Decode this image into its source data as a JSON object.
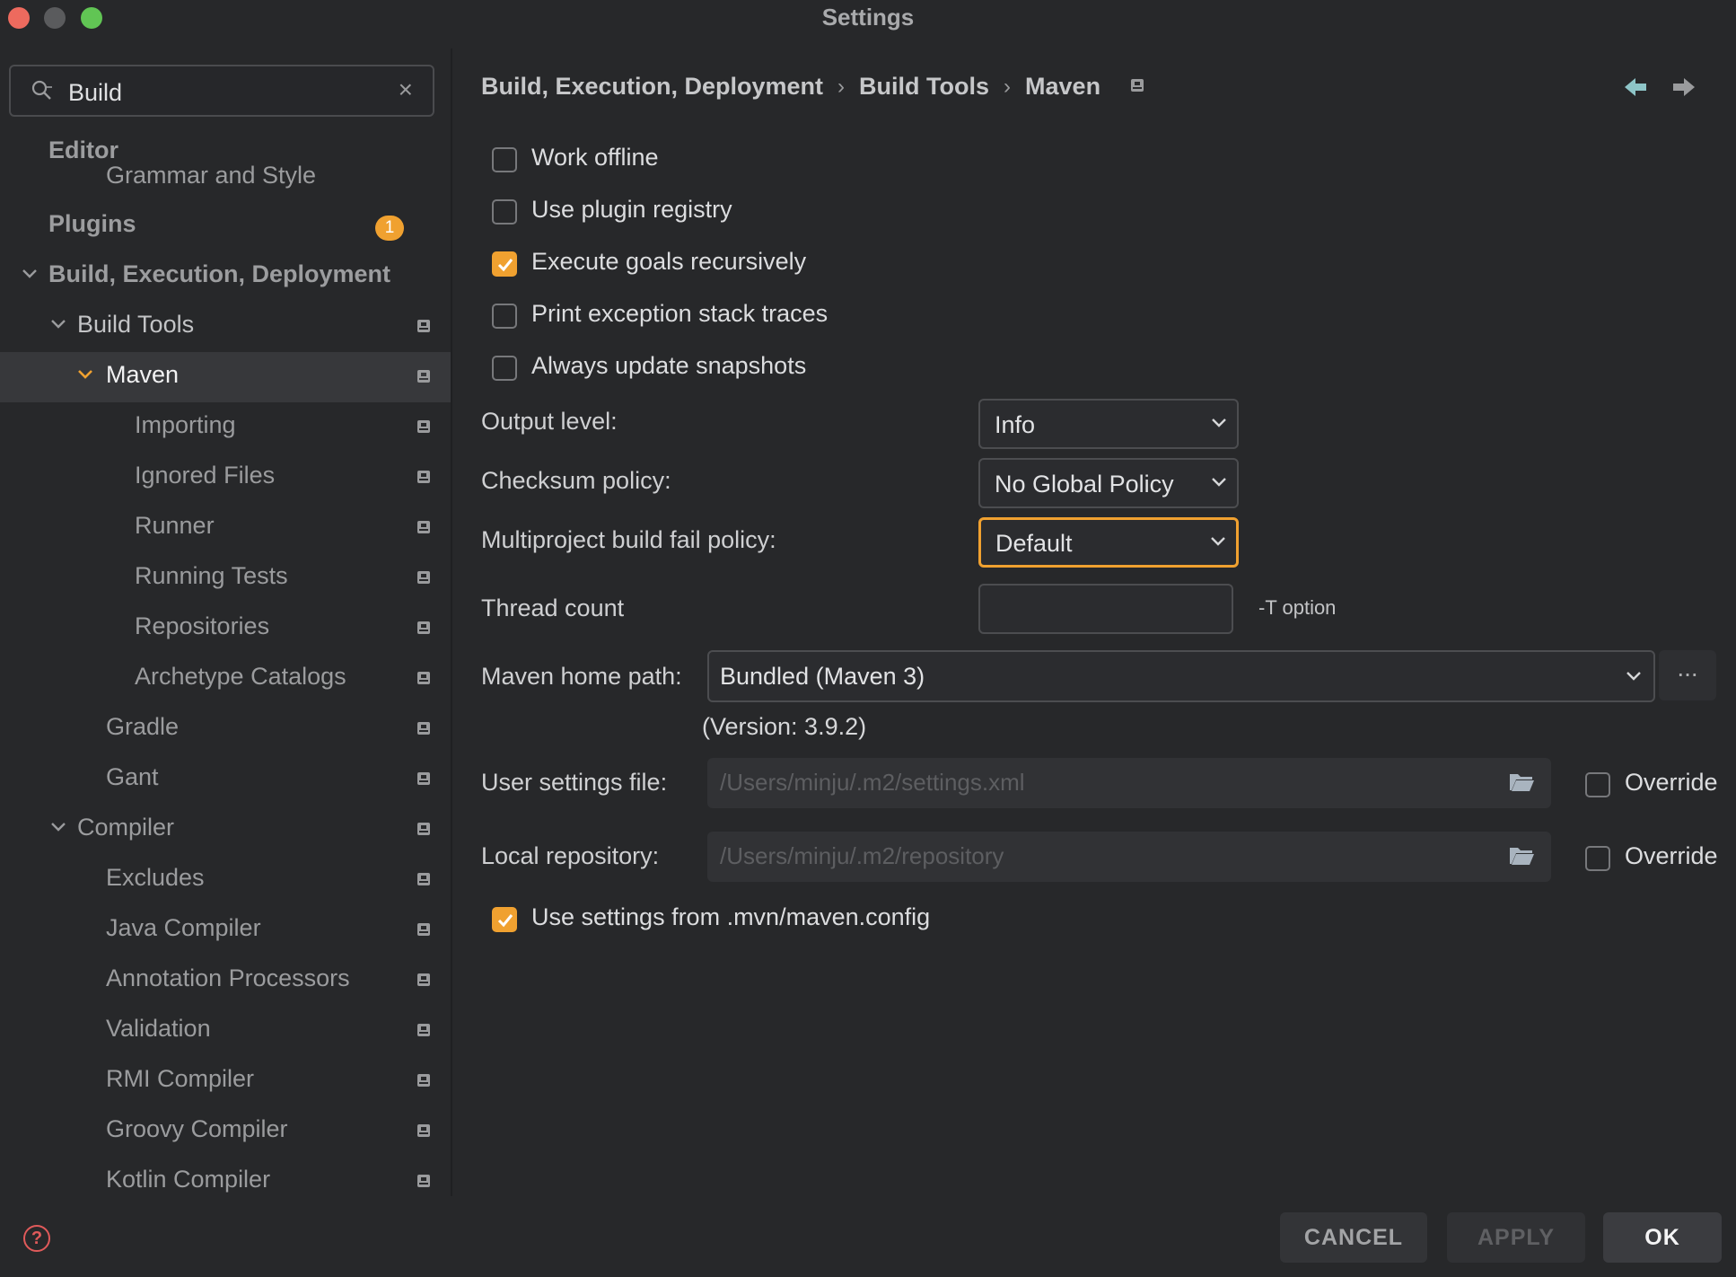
{
  "window": {
    "title": "Settings"
  },
  "search": {
    "value": "Build"
  },
  "sidebar": {
    "items": [
      {
        "label": "Editor"
      },
      {
        "label": "Grammar and Style"
      },
      {
        "label": "Plugins",
        "badge": "1"
      },
      {
        "label": "Build, Execution, Deployment"
      },
      {
        "label": "Build Tools"
      },
      {
        "label": "Maven"
      },
      {
        "label": "Importing"
      },
      {
        "label": "Ignored Files"
      },
      {
        "label": "Runner"
      },
      {
        "label": "Running Tests"
      },
      {
        "label": "Repositories"
      },
      {
        "label": "Archetype Catalogs"
      },
      {
        "label": "Gradle"
      },
      {
        "label": "Gant"
      },
      {
        "label": "Compiler"
      },
      {
        "label": "Excludes"
      },
      {
        "label": "Java Compiler"
      },
      {
        "label": "Annotation Processors"
      },
      {
        "label": "Validation"
      },
      {
        "label": "RMI Compiler"
      },
      {
        "label": "Groovy Compiler"
      },
      {
        "label": "Kotlin Compiler"
      }
    ]
  },
  "breadcrumb": [
    "Build, Execution, Deployment",
    "Build Tools",
    "Maven"
  ],
  "options": {
    "work_offline": {
      "label": "Work offline",
      "checked": false
    },
    "use_plugin_registry": {
      "label": "Use plugin registry",
      "checked": false
    },
    "execute_goals_recursively": {
      "label": "Execute goals recursively",
      "checked": true
    },
    "print_exception_stack_traces": {
      "label": "Print exception stack traces",
      "checked": false
    },
    "always_update_snapshots": {
      "label": "Always update snapshots",
      "checked": false
    },
    "use_mvn_config": {
      "label": "Use settings from .mvn/maven.config",
      "checked": true
    }
  },
  "form": {
    "output_level": {
      "label": "Output level:",
      "value": "Info"
    },
    "checksum_policy": {
      "label": "Checksum policy:",
      "value": "No Global Policy"
    },
    "fail_policy": {
      "label": "Multiproject build fail policy:",
      "value": "Default"
    },
    "thread_count": {
      "label": "Thread count",
      "value": "",
      "hint": "-T option"
    },
    "maven_home": {
      "label": "Maven home path:",
      "value": "Bundled (Maven 3)",
      "version": "(Version: 3.9.2)",
      "browse": "..."
    },
    "user_settings": {
      "label": "User settings file:",
      "placeholder": "/Users/minju/.m2/settings.xml",
      "override": "Override",
      "override_checked": false
    },
    "local_repo": {
      "label": "Local repository:",
      "placeholder": "/Users/minju/.m2/repository",
      "override": "Override",
      "override_checked": false
    }
  },
  "footer": {
    "cancel": "CANCEL",
    "apply": "APPLY",
    "ok": "OK",
    "help": "?"
  },
  "colors": {
    "accent": "#f0a130",
    "background": "#27282a",
    "selected": "#37383b"
  }
}
